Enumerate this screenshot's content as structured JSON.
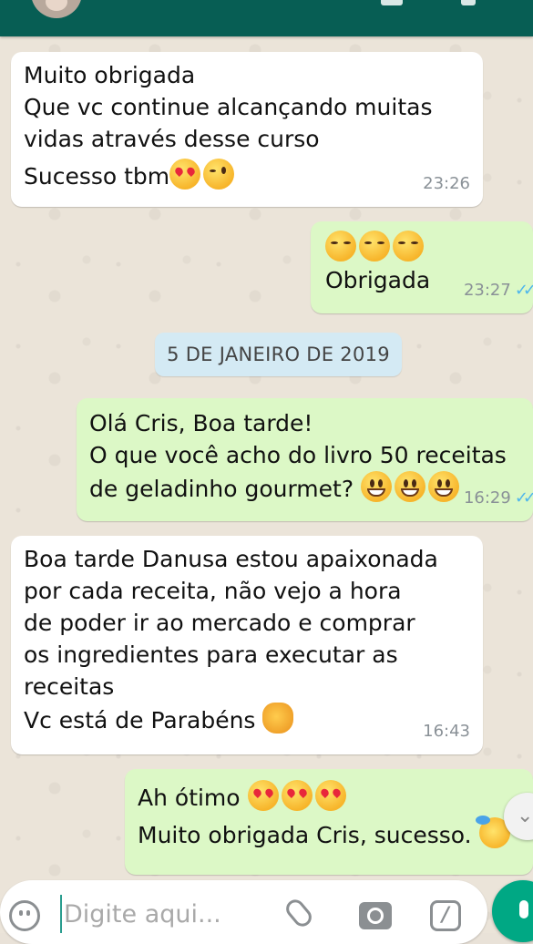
{
  "messages": [
    {
      "lines": [
        "Muito obrigada",
        "Que vc continue alcançando muitas",
        "vidas através desse curso",
        "Sucesso tbm"
      ],
      "time": "23:26"
    },
    {
      "lines": [
        "Obrigada"
      ],
      "time": "23:27",
      "status": "read"
    },
    {
      "lines": [
        "Olá Cris, Boa tarde!",
        "O que você acho do livro 50 receitas",
        "de geladinho gourmet?"
      ],
      "time": "16:29",
      "status": "read"
    },
    {
      "lines": [
        "Boa tarde Danusa estou apaixonada",
        "por cada receita, não vejo a hora",
        "de poder ir ao mercado e comprar",
        "os ingredientes para executar as",
        "receitas",
        "Vc está de Parabéns"
      ],
      "time": "16:43"
    },
    {
      "lines": [
        "Ah ótimo",
        "Muito obrigada Cris, sucesso."
      ]
    }
  ],
  "date_divider": "5 DE JANEIRO DE 2019",
  "composer": {
    "placeholder": "Digite aqui..."
  },
  "icons": {
    "emoji": "emoji-icon",
    "attach": "paperclip-icon",
    "camera": "camera-icon",
    "doodle": "pen-icon",
    "mic": "mic-icon",
    "scroll": "chevron-down-icon",
    "read_status": "double-check-icon"
  },
  "colors": {
    "header": "#075e54",
    "outgoing_bubble": "#dcf8c6",
    "incoming_bubble": "#ffffff",
    "date_chip": "#d4eaf4",
    "read_ticks": "#4fb6ec",
    "send_button": "#00a884"
  }
}
